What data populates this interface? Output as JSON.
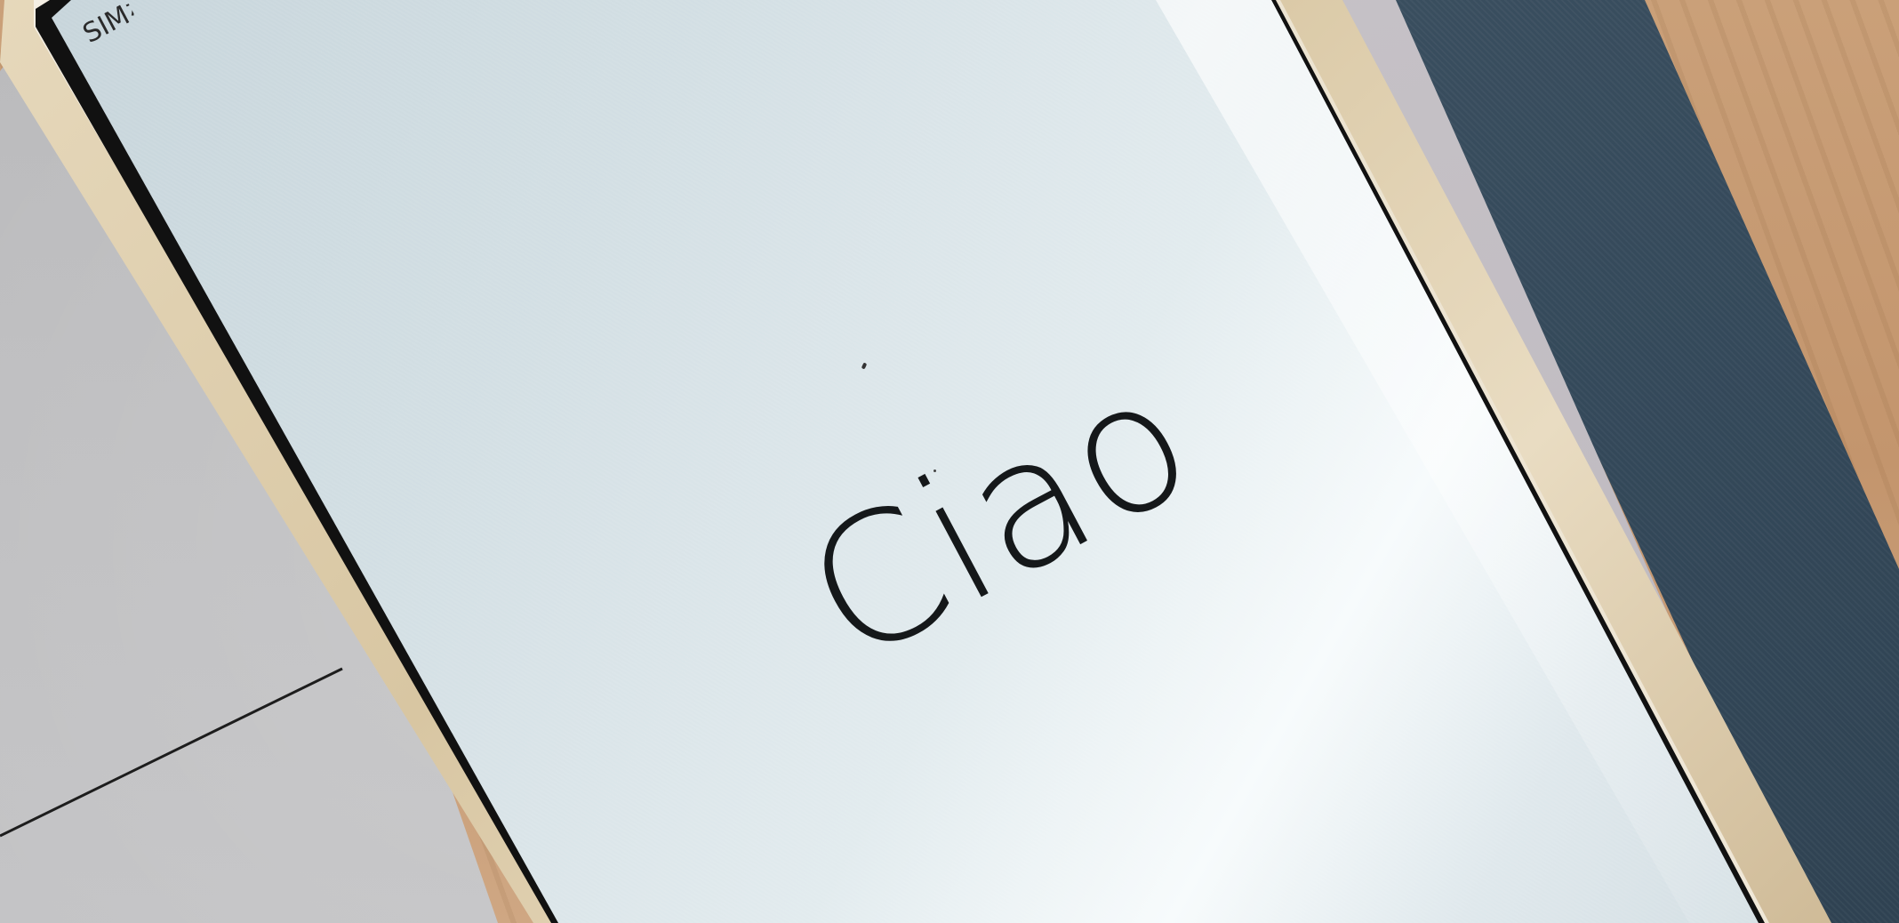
{
  "screen": {
    "status_bar_text": "SIMな",
    "greeting": "Ciao"
  },
  "colors": {
    "screen_background": "#dfe8ec",
    "text": "#15181a",
    "phone_frame": "#e6d8bb",
    "cover": "#3f5363",
    "wood": "#caa079"
  }
}
